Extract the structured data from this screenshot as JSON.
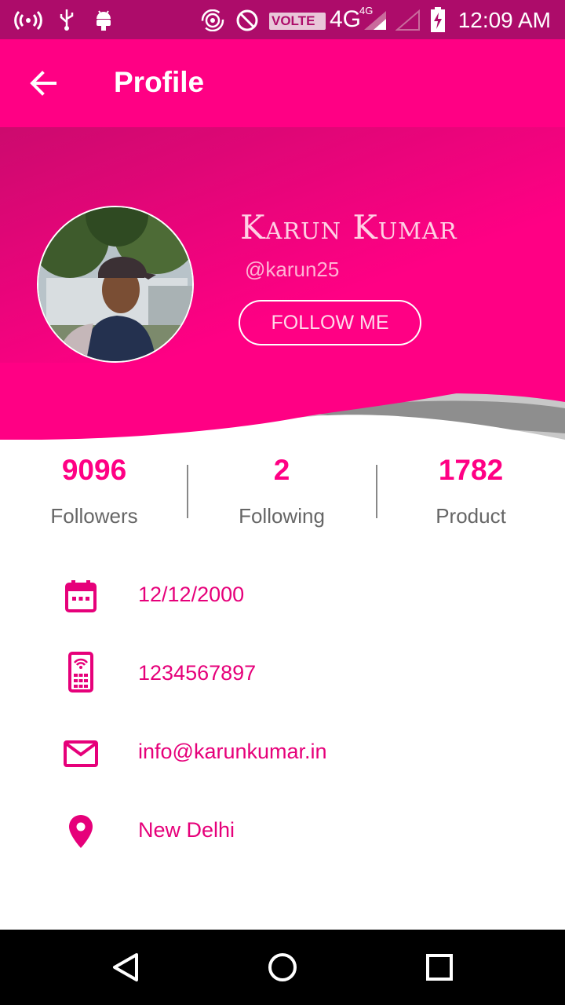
{
  "status_bar": {
    "time": "12:09 AM",
    "volte": "VOLTE 1",
    "network": "4G",
    "network_small": "4G",
    "icons": [
      "hotspot-icon",
      "usb-icon",
      "android-icon",
      "wifi-calling-icon",
      "do-not-disturb-icon",
      "signal-icon",
      "signal-empty-icon",
      "battery-charging-icon"
    ]
  },
  "app_bar": {
    "title": "Profile",
    "back_icon": "arrow-back-icon"
  },
  "profile": {
    "name": "Karun Kumar",
    "handle": "@karun25",
    "follow_label": "FOLLOW ME"
  },
  "stats": [
    {
      "value": "9096",
      "label": "Followers"
    },
    {
      "value": "2",
      "label": "Following"
    },
    {
      "value": "1782",
      "label": "Product"
    }
  ],
  "info": [
    {
      "icon": "calendar-icon",
      "text": "12/12/2000"
    },
    {
      "icon": "phone-icon",
      "text": "1234567897"
    },
    {
      "icon": "email-icon",
      "text": "info@karunkumar.in"
    },
    {
      "icon": "location-pin-icon",
      "text": "New Delhi"
    }
  ],
  "colors": {
    "primary": "#ff0084",
    "status_bar": "#ad0c6a",
    "wave_gray": "#9a9a9a"
  },
  "nav_bar": {
    "icons": [
      "back-triangle-icon",
      "home-circle-icon",
      "recents-square-icon"
    ]
  }
}
